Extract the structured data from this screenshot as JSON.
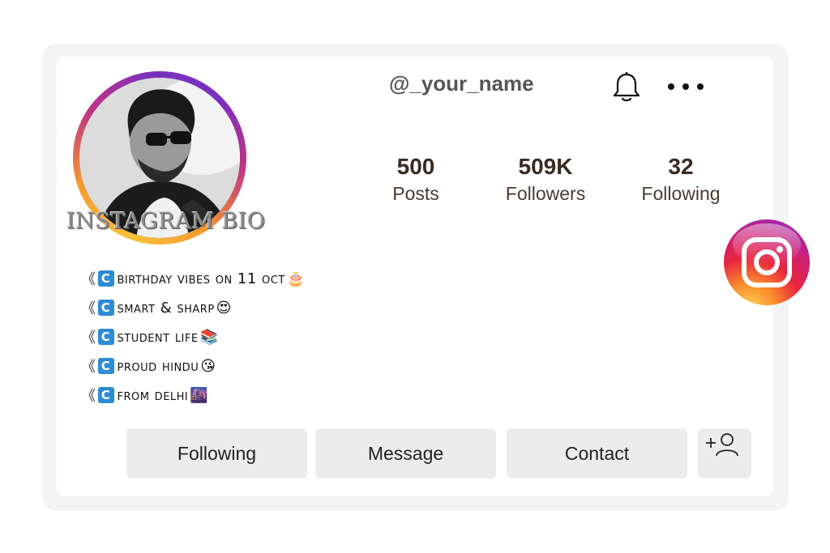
{
  "profile": {
    "username": "@_your_name",
    "watermark": "INSTAGRAM BIO"
  },
  "icons": {
    "bell": "bell-icon",
    "more": "more-dots-icon",
    "instagram": "instagram-logo-icon",
    "add_user": "add-user-icon"
  },
  "stats": [
    {
      "value": "500",
      "label": "Posts"
    },
    {
      "value": "509K",
      "label": "Followers"
    },
    {
      "value": "32",
      "label": "Following"
    }
  ],
  "bio": [
    {
      "prefix": "《",
      "badge": "C",
      "text": "birthday vibes on 11 oct",
      "emoji": "🎂"
    },
    {
      "prefix": "《",
      "badge": "C",
      "text": "smart & sharp",
      "emoji": "😍"
    },
    {
      "prefix": "《",
      "badge": "C",
      "text": "student life ",
      "emoji": "📚"
    },
    {
      "prefix": "《",
      "badge": "C",
      "text": "proud hindu",
      "emoji": "😘"
    },
    {
      "prefix": "《",
      "badge": "C",
      "text": "from delhi",
      "emoji": "🌆"
    }
  ],
  "actions": {
    "following": "Following",
    "message": "Message",
    "contact": "Contact"
  },
  "colors": {
    "button_bg": "#ececec",
    "stat_text": "#3a2a20",
    "badge_blue": "#2d8cd6"
  }
}
